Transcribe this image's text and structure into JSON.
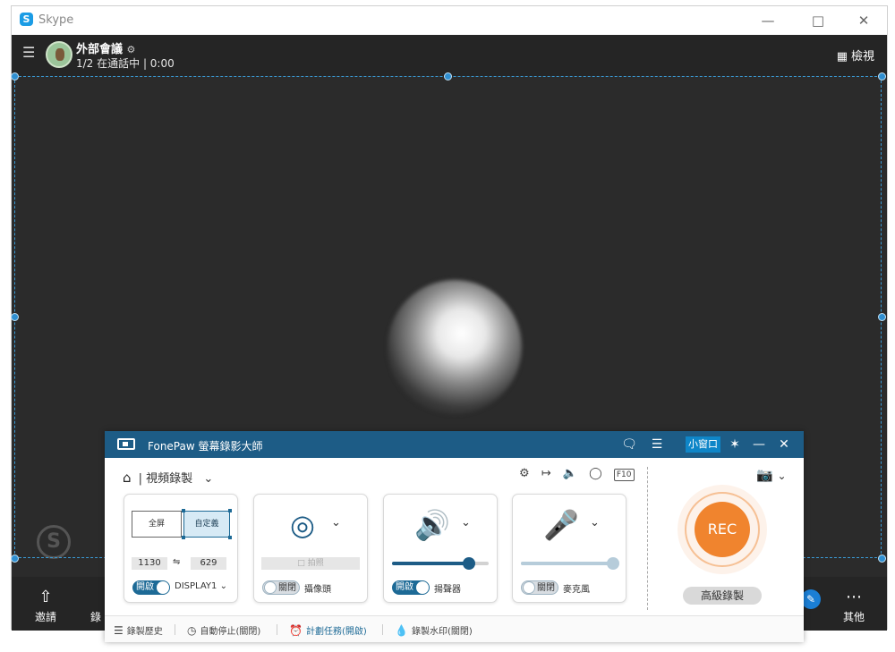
{
  "skype": {
    "window_title": "Skype",
    "logo": "S",
    "call_name": "外部會議",
    "call_status": "1/2 在通話中 | 0:00",
    "view_label": "檢視",
    "bottom": {
      "invite_label": "邀請",
      "partial_label": "錄",
      "more_label": "其他"
    }
  },
  "fonepaw": {
    "app_title": "FonePaw 螢幕錄影大師",
    "mini_window_label": "小窗口",
    "mode_label": "| 視頻錄製",
    "f10": "F10",
    "screen": {
      "full_label": "全屏",
      "custom_label": "自定義",
      "width": "1130",
      "height": "629",
      "toggle_label": "開啟",
      "display_label": "DISPLAY1"
    },
    "webcam": {
      "snap_label": "拍照",
      "toggle_label": "關閉",
      "label": "攝像頭",
      "enabled": false
    },
    "speaker": {
      "toggle_label": "開啟",
      "label": "揚聲器",
      "volume": 0.8
    },
    "mic": {
      "toggle_label": "關閉",
      "label": "麥克風",
      "volume": 0.95
    },
    "rec_label": "REC",
    "advanced_label": "高級錄製",
    "footer": {
      "history": "錄製歷史",
      "auto_stop": "自動停止(關閉)",
      "schedule": "計劃任務(開啟)",
      "watermark": "錄製水印(關閉)"
    }
  },
  "colors": {
    "fonepaw_title_bg": "#1d5c86",
    "rec_orange": "#f0842e",
    "accent_blue": "#1d6a96",
    "selection_blue": "#3a9bd6"
  }
}
